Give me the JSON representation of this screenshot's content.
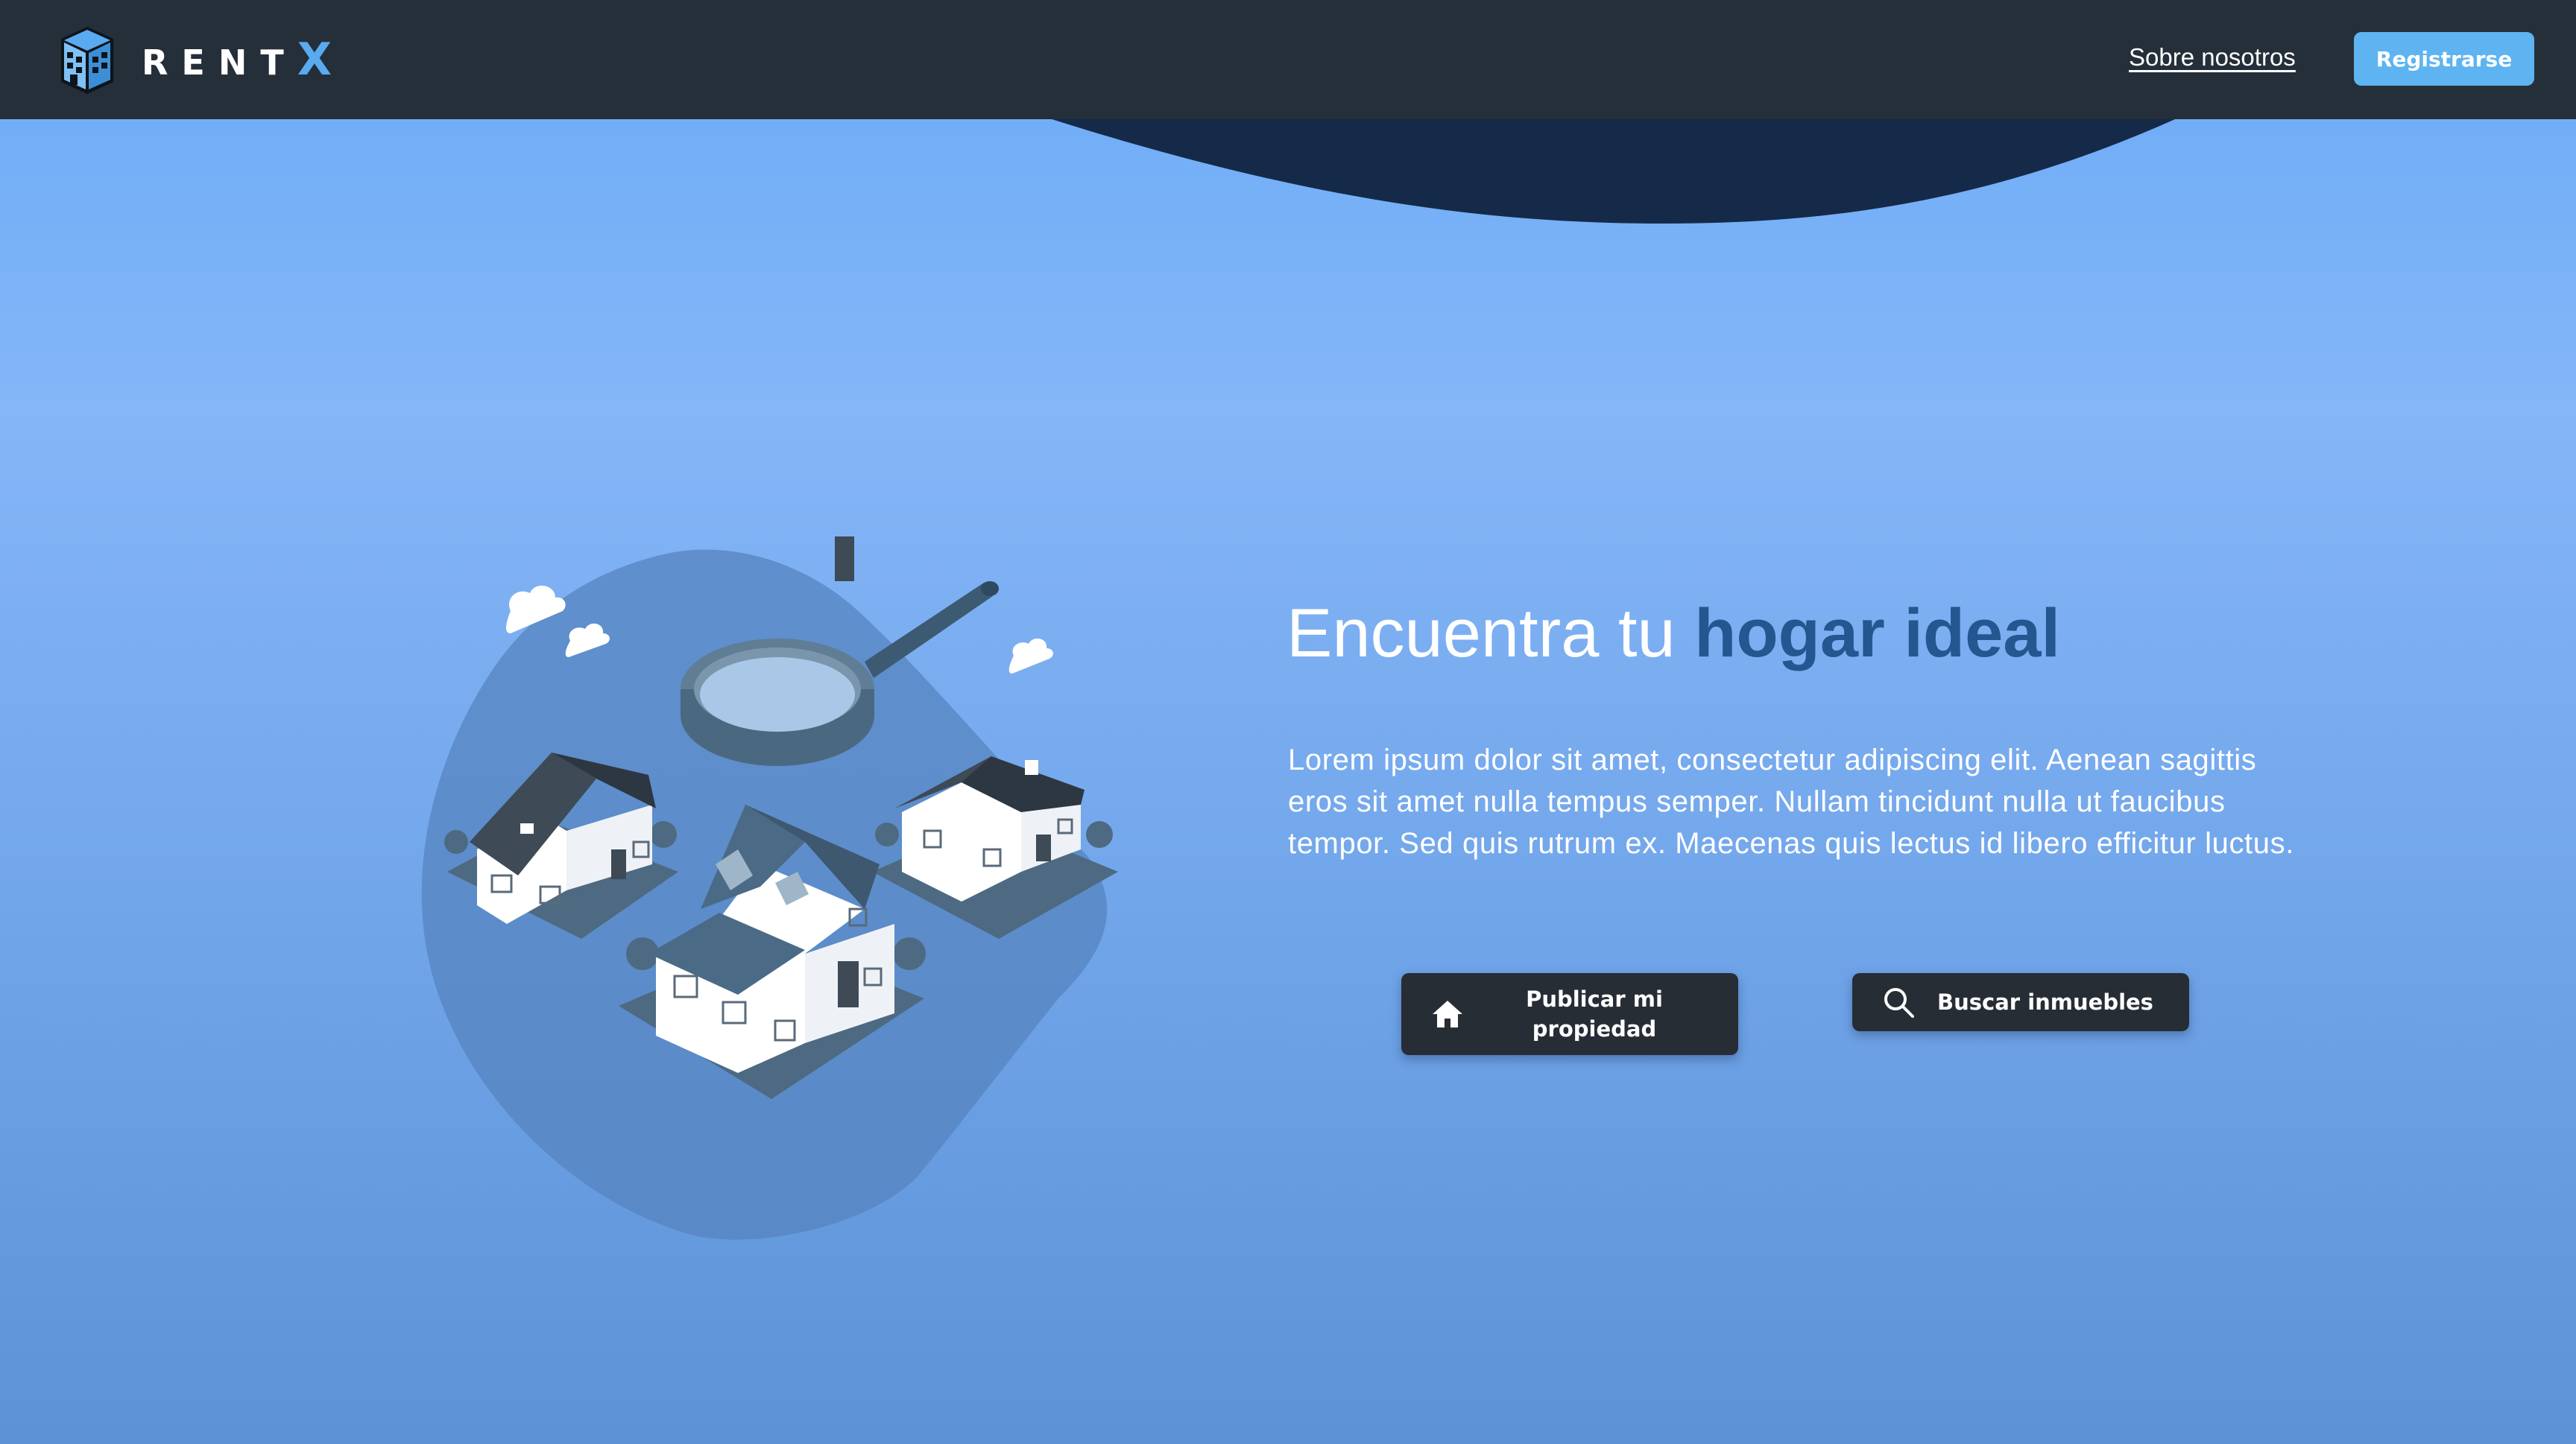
{
  "header": {
    "logo_text": "RENT",
    "logo_accent": "X",
    "nav_link": "Sobre nosotros",
    "register_label": "Registrarse"
  },
  "hero": {
    "title_plain": "Encuentra tu ",
    "title_accent": "hogar ideal",
    "description": "Lorem ipsum dolor sit amet, consectetur adipiscing elit. Aenean sagittis eros sit amet nulla tempus semper. Nullam tincidunt nulla ut faucibus tempor. Sed quis rutrum ex. Maecenas quis lectus id libero efficitur luctus.",
    "buttons": [
      {
        "label": "Publicar mi propiedad",
        "icon": "home-icon"
      },
      {
        "label": "Buscar inmuebles",
        "icon": "search-icon"
      }
    ]
  },
  "colors": {
    "navbar": "#252f3a",
    "wave": "#152a48",
    "accent_text": "#24578f",
    "register_button": "#5db4f0",
    "cta_button": "#262d35",
    "logo_accent": "#5aaaf0"
  }
}
